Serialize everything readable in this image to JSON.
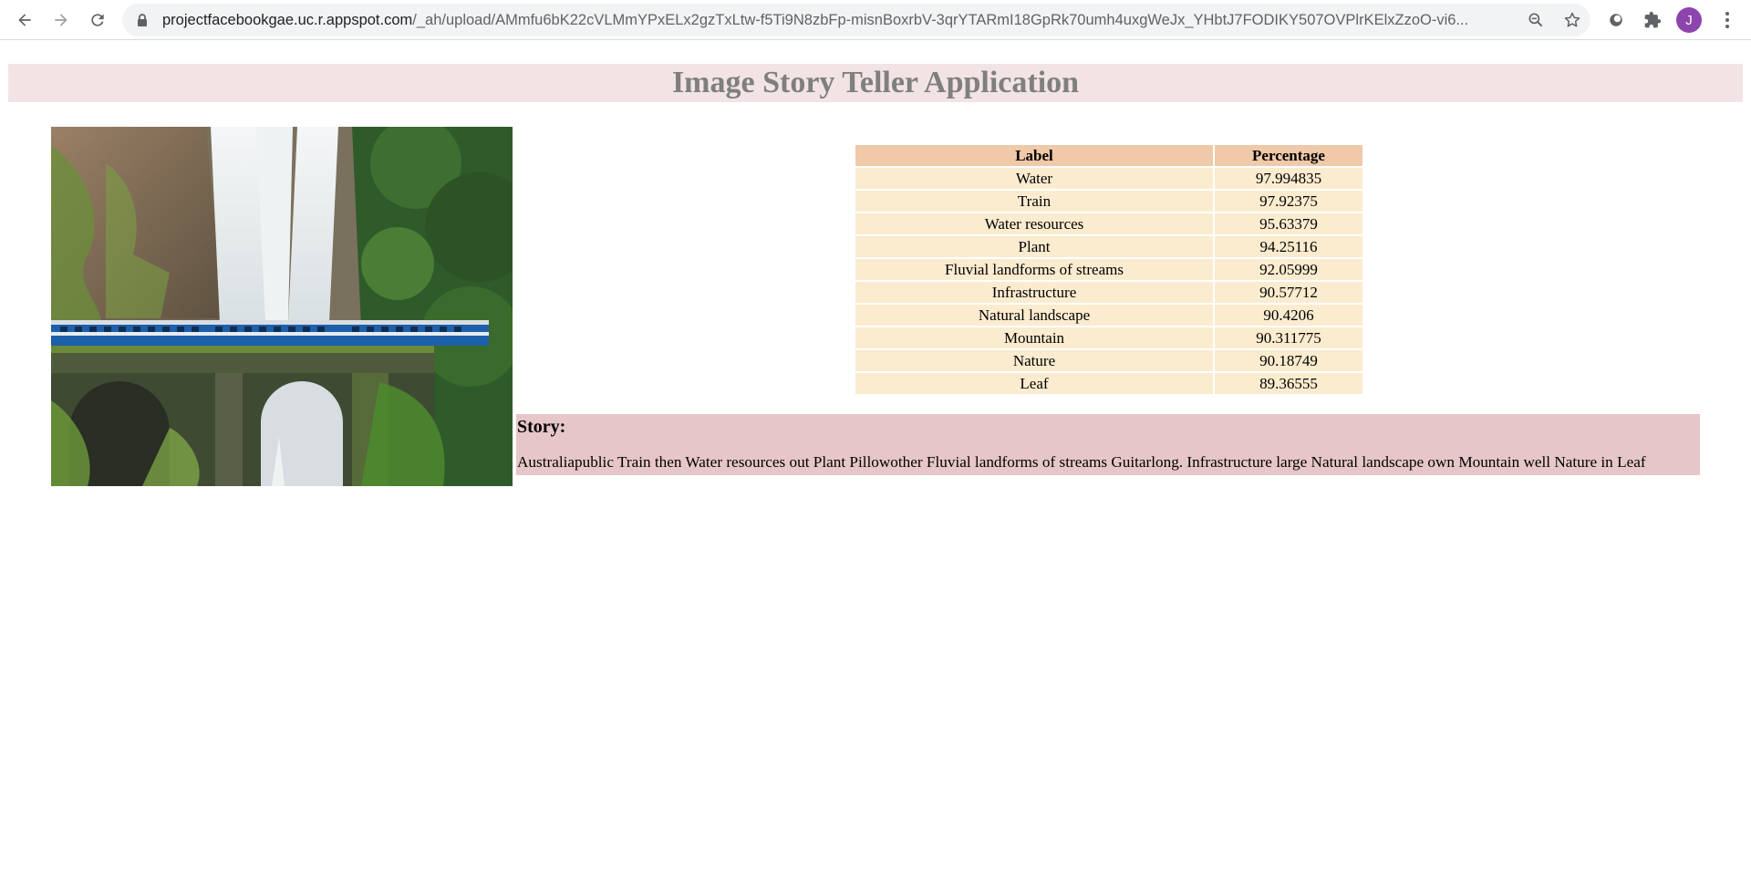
{
  "browser": {
    "url_host": "projectfacebookgae.uc.r.appspot.com",
    "url_path": "/_ah/upload/AMmfu6bK22cVLMmYPxELx2gzTxLtw-f5Ti9N8zbFp-misnBoxrbV-3qrYTARmI18GpRk70umh4uxgWeJx_YHbtJ7FODIKY507OVPlrKElxZzoO-vi6...",
    "avatar_letter": "J",
    "avatar_color": "#8e44ad"
  },
  "page": {
    "title": "Image Story Teller Application",
    "table": {
      "headers": [
        "Label",
        "Percentage"
      ],
      "rows": [
        {
          "label": "Water",
          "percentage": "97.994835"
        },
        {
          "label": "Train",
          "percentage": "97.92375"
        },
        {
          "label": "Water resources",
          "percentage": "95.63379"
        },
        {
          "label": "Plant",
          "percentage": "94.25116"
        },
        {
          "label": "Fluvial landforms of streams",
          "percentage": "92.05999"
        },
        {
          "label": "Infrastructure",
          "percentage": "90.57712"
        },
        {
          "label": "Natural landscape",
          "percentage": "90.4206"
        },
        {
          "label": "Mountain",
          "percentage": "90.311775"
        },
        {
          "label": "Nature",
          "percentage": "90.18749"
        },
        {
          "label": "Leaf",
          "percentage": "89.36555"
        }
      ]
    },
    "story": {
      "heading": "Story:",
      "text": "Australiapublic Train then Water resources out Plant Pillowother Fluvial landforms of streams Guitarlong. Infrastructure large Natural landscape own Mountain well Nature in Leaf"
    }
  },
  "colors": {
    "header_bg": "#f2e3e4",
    "header_text": "#7f7f7f",
    "table_header_bg": "#efc9a8",
    "table_cell_bg": "#fbebcf",
    "story_bg": "#e6c6c8"
  }
}
